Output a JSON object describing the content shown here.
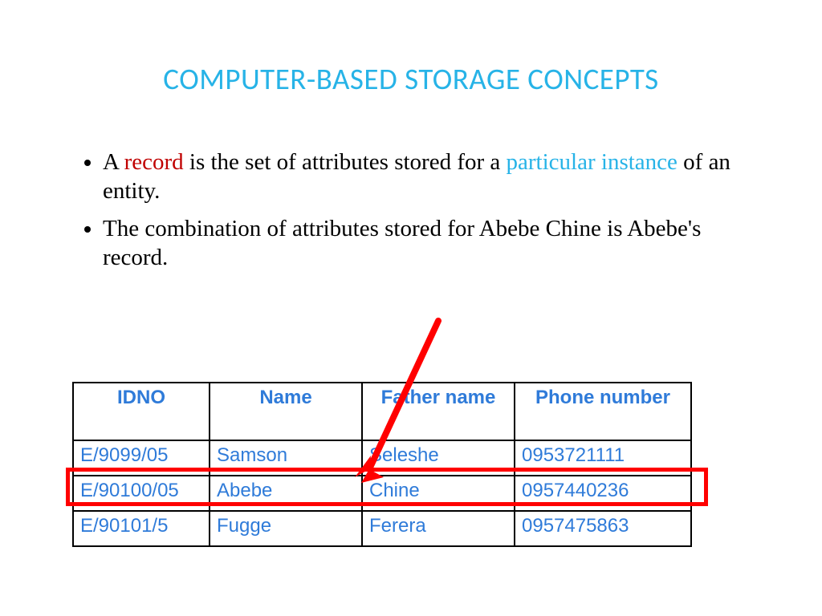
{
  "title": "COMPUTER-BASED STORAGE CONCEPTS",
  "bullet1": {
    "a": "A ",
    "record": "record",
    "b": " is the set of attributes stored for a ",
    "particular_instance": "particular instance",
    "c": " of an entity."
  },
  "bullet2": "The combination of attributes stored for Abebe  Chine is Abebe's record.",
  "table": {
    "headers": [
      "IDNO",
      "Name",
      "Father name",
      "Phone number"
    ],
    "rows": [
      [
        "E/9099/05",
        "Samson",
        "Seleshe",
        "0953721111"
      ],
      [
        "E/90100/05",
        "Abebe",
        "Chine",
        "0957440236"
      ],
      [
        "E/90101/5",
        "Fugge",
        "Ferera",
        "0957475863"
      ]
    ]
  },
  "highlight_row_index": 1
}
